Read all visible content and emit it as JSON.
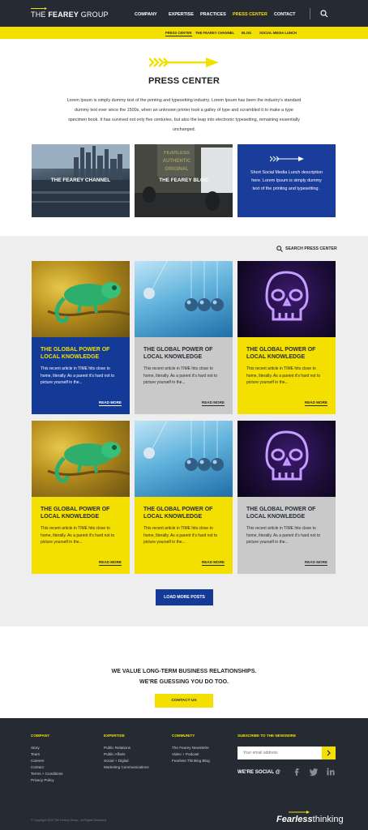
{
  "header": {
    "logo_prefix": "THE",
    "logo_brand": "FEAREY",
    "logo_suffix": "GROUP",
    "nav": [
      "COMPANY",
      "EXPERTISE",
      "PRACTICES",
      "PRESS CENTER",
      "CONTACT"
    ],
    "active_nav": "PRESS CENTER",
    "search_icon": "search-icon"
  },
  "subnav": [
    "PRESS CENTER",
    "THE FEAREY CHANNEL",
    "BLOG",
    "SOCIAL MEDIA LUNCH"
  ],
  "hero": {
    "title": "PRESS CENTER",
    "text": "Lorem Ipsum is simply dummy text of the printing and typesetting industry. Lorem Ipsum has been the industry's standard dummy text ever since the 1500s, when an unknown printer took a galley of type and scrambled it to make a type specimen book. It has survived not only five centuries, but also the leap into electronic typesetting, remaining essentially unchanged."
  },
  "tiles": {
    "channel": "THE FEAREY CHANNEL",
    "blog": "THE FEAREY BLOG",
    "blog_sign": "FEARLESS AUTHENTIC ORIGINAL",
    "social_text": "Short Social Media Lunch description here. Lorem Ipsum is simply dummy text of the printing and typesetting ."
  },
  "search_press": "SEARCH PRESS CENTER",
  "cards": [
    {
      "title": "THE GLOBAL POWER OF LOCAL KNOWLEDGE",
      "text": "This recent article in TIME hits close to home, literally. As a parent it's hard not to picture yourself in the...",
      "more": "READ MORE"
    },
    {
      "title": "THE GLOBAL POWER OF LOCAL KNOWLEDGE",
      "text": "This recent article in TIME hits close to home, literally. As a parent it's hard not to picture yourself in the...",
      "more": "READ MORE"
    },
    {
      "title": "THE GLOBAL POWER OF LOCAL KNOWLEDGE",
      "text": "This recent article in TIME hits close to home, literally. As a parent it's hard not to picture yourself in the...",
      "more": "READ MORE"
    },
    {
      "title": "THE GLOBAL POWER OF LOCAL KNOWLEDGE",
      "text": "This recent article in TIME hits close to home, literally. As a parent it's hard not to picture yourself in the...",
      "more": "READ MORE"
    },
    {
      "title": "THE GLOBAL POWER OF LOCAL KNOWLEDGE",
      "text": "This recent article in TIME hits close to home, literally. As a parent it's hard not to picture yourself in the...",
      "more": "READ MORE"
    },
    {
      "title": "THE GLOBAL POWER OF LOCAL KNOWLEDGE",
      "text": "This recent article in TIME hits close to home, literally. As a parent it's hard not to picture yourself in the...",
      "more": "READ MORE"
    }
  ],
  "load_more": "LOAD MORE POSTS",
  "value": {
    "line1": "WE VALUE LONG-TERM BUSINESS RELATIONSHIPS.",
    "line2": "WE'RE GUESSING YOU DO TOO.",
    "button": "CONTACT US"
  },
  "footer": {
    "company": {
      "heading": "COMPANY",
      "links": [
        "Story",
        "Team",
        "Careers",
        "Contact",
        "Terms + Conditions",
        "Privacy Policy"
      ]
    },
    "expertise": {
      "heading": "EXPERTISE",
      "links": [
        "Public Relations",
        "Public Affairs",
        "Social + Digital",
        "Marketing Communications"
      ]
    },
    "community": {
      "heading": "COMMUNITY",
      "links": [
        "The Fearey NewsWire",
        "Video + Podcast",
        "Fearless Thinking Blog"
      ]
    },
    "newsletter": {
      "heading": "SUBSCRIBE TO THE NEWSWIRE",
      "placeholder": "Your email address"
    },
    "social_label": "WE'RE SOCIAL @",
    "copyright": "© Copyright 2015 The Fearey Group - All Rights Reserved",
    "logo_bold": "Fearless",
    "logo_light": "thinking"
  },
  "colors": {
    "dark": "#252a33",
    "yellow": "#f3e000",
    "blue": "#133a97",
    "gray": "#c9c9c9"
  }
}
